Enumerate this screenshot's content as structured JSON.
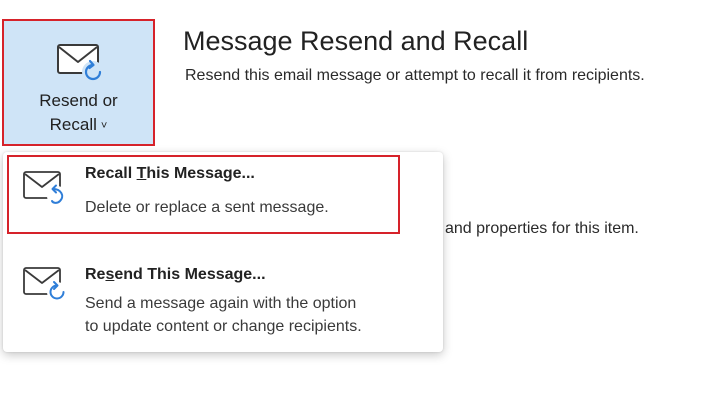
{
  "ribbon": {
    "resend_recall_button": {
      "line1": "Resend or",
      "line2": "Recall",
      "chevron": "˅",
      "icon": "envelope-refresh-icon"
    }
  },
  "panel": {
    "title": "Message Resend and Recall",
    "subtitle": "Resend this email message or attempt to recall it from recipients.",
    "partial_text": "and properties for this item."
  },
  "menu": {
    "recall": {
      "title_pre": "Recall ",
      "title_underlined": "T",
      "title_post": "his Message...",
      "description": "Delete or replace a sent message.",
      "icon": "envelope-recall-icon"
    },
    "resend": {
      "title_pre": "Re",
      "title_underlined": "s",
      "title_post": "end This Message...",
      "description_line1": "Send a message again with the option",
      "description_line2": "to update content or change recipients.",
      "icon": "envelope-resend-icon"
    }
  },
  "colors": {
    "highlight_border": "#d6222a",
    "button_background": "#cfe4f7",
    "icon_accent": "#2f7ed8"
  }
}
